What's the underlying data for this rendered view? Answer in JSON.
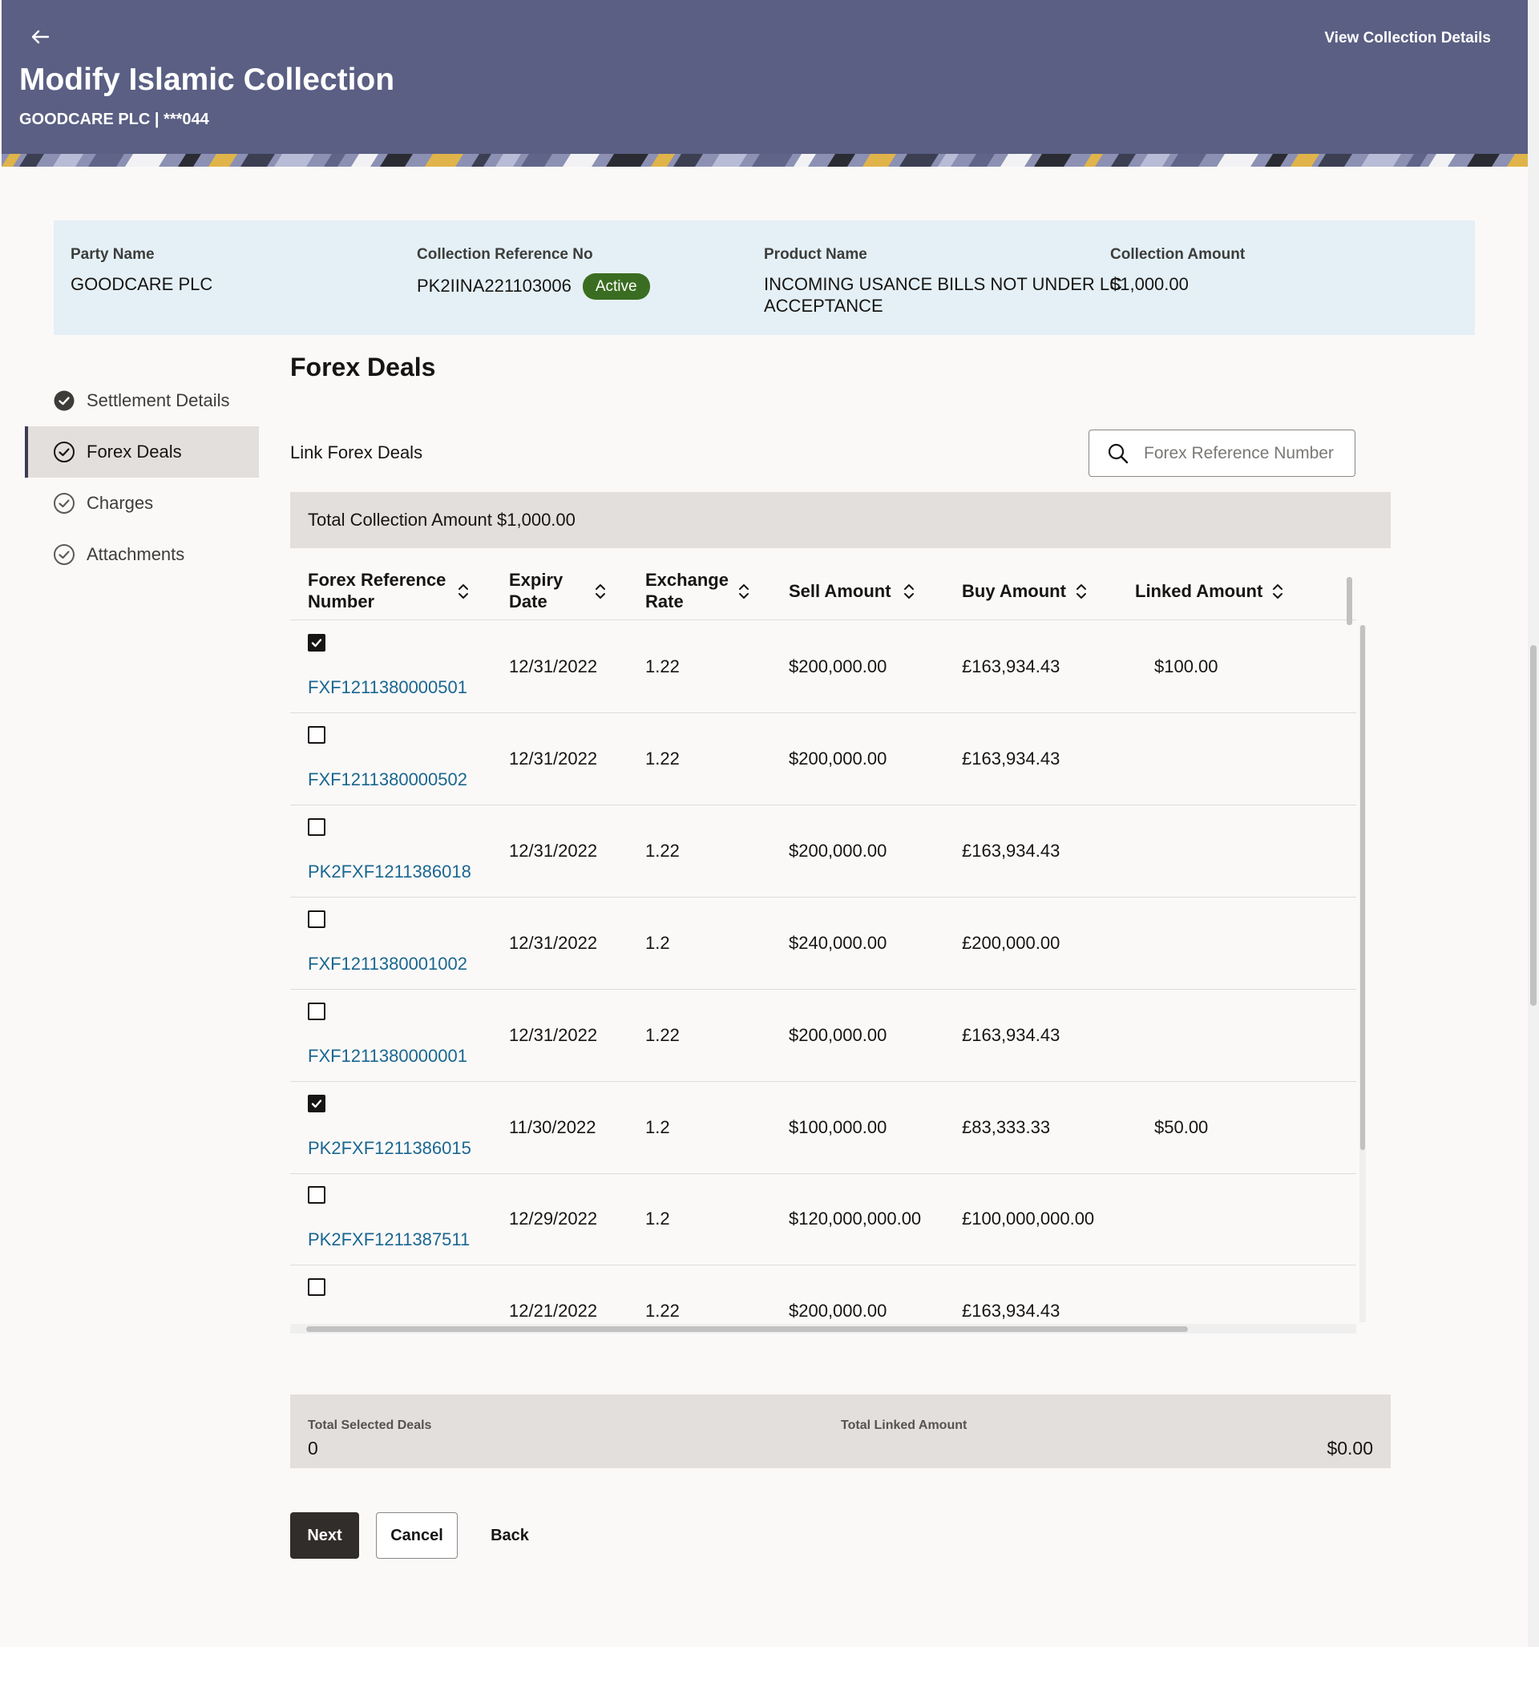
{
  "header": {
    "title": "Modify Islamic Collection",
    "subtitle": "GOODCARE PLC | ***044",
    "view_details_link": "View Collection Details"
  },
  "summary": {
    "party_name_label": "Party Name",
    "party_name": "GOODCARE PLC",
    "collection_ref_label": "Collection Reference No",
    "collection_ref": "PK2IINA221103006",
    "status": "Active",
    "product_name_label": "Product Name",
    "product_name_line1": "INCOMING USANCE BILLS NOT UNDER LC",
    "product_name_line2": "ACCEPTANCE",
    "collection_amount_label": "Collection Amount",
    "collection_amount": "$1,000.00"
  },
  "nav": {
    "items": [
      {
        "label": "Settlement Details",
        "state": "complete"
      },
      {
        "label": "Forex Deals",
        "state": "active"
      },
      {
        "label": "Charges",
        "state": "incomplete"
      },
      {
        "label": "Attachments",
        "state": "incomplete"
      }
    ]
  },
  "main": {
    "title": "Forex Deals",
    "link_label": "Link Forex Deals",
    "search_placeholder": "Forex Reference Number",
    "total_collection": "Total Collection Amount $1,000.00"
  },
  "table": {
    "columns": {
      "ref_line1": "Forex Reference",
      "ref_line2": "Number",
      "expiry_line1": "Expiry",
      "expiry_line2": "Date",
      "rate_line1": "Exchange",
      "rate_line2": "Rate",
      "sell": "Sell Amount",
      "buy": "Buy Amount",
      "linked": "Linked Amount"
    },
    "rows": [
      {
        "checked": true,
        "ref": "FXF1211380000501",
        "expiry": "12/31/2022",
        "rate": "1.22",
        "sell": "$200,000.00",
        "buy": "£163,934.43",
        "linked": "$100.00"
      },
      {
        "checked": false,
        "ref": "FXF1211380000502",
        "expiry": "12/31/2022",
        "rate": "1.22",
        "sell": "$200,000.00",
        "buy": "£163,934.43",
        "linked": ""
      },
      {
        "checked": false,
        "ref": "PK2FXF1211386018",
        "expiry": "12/31/2022",
        "rate": "1.22",
        "sell": "$200,000.00",
        "buy": "£163,934.43",
        "linked": ""
      },
      {
        "checked": false,
        "ref": "FXF1211380001002",
        "expiry": "12/31/2022",
        "rate": "1.2",
        "sell": "$240,000.00",
        "buy": "£200,000.00",
        "linked": ""
      },
      {
        "checked": false,
        "ref": "FXF1211380000001",
        "expiry": "12/31/2022",
        "rate": "1.22",
        "sell": "$200,000.00",
        "buy": "£163,934.43",
        "linked": ""
      },
      {
        "checked": true,
        "ref": "PK2FXF1211386015",
        "expiry": "11/30/2022",
        "rate": "1.2",
        "sell": "$100,000.00",
        "buy": "£83,333.33",
        "linked": "$50.00"
      },
      {
        "checked": false,
        "ref": "PK2FXF1211387511",
        "expiry": "12/29/2022",
        "rate": "1.2",
        "sell": "$120,000,000.00",
        "buy": "£100,000,000.00",
        "linked": ""
      },
      {
        "checked": false,
        "ref": "",
        "expiry": "12/21/2022",
        "rate": "1.22",
        "sell": "$200,000.00",
        "buy": "£163,934.43",
        "linked": ""
      }
    ]
  },
  "totals": {
    "selected_label": "Total Selected Deals",
    "selected_value": "0",
    "linked_label": "Total Linked Amount",
    "linked_value": "$0.00"
  },
  "buttons": {
    "next": "Next",
    "cancel": "Cancel",
    "back": "Back"
  },
  "colors": {
    "header_bg": "#5a5f83",
    "summary_bg": "#e4f0f5",
    "badge_active": "#3a6d22",
    "link": "#1a6791",
    "primary_button": "#312d2a"
  }
}
